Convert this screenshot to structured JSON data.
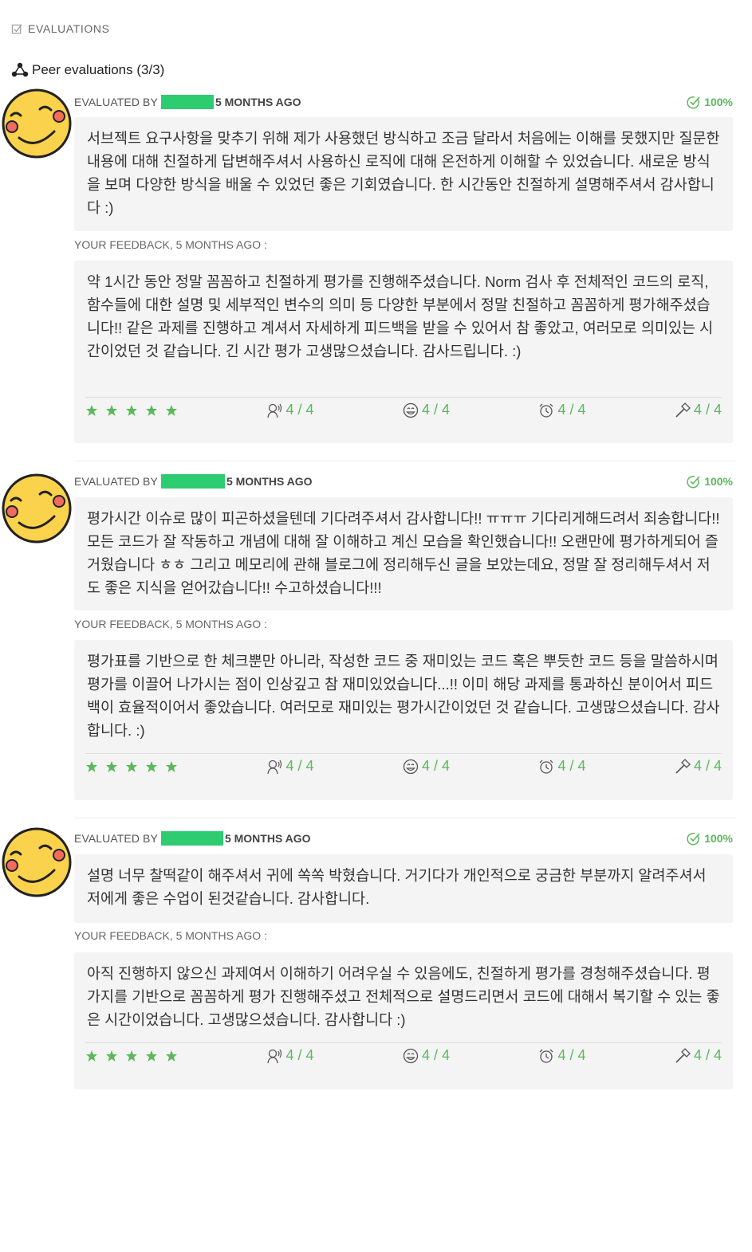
{
  "header": {
    "label": "EVALUATIONS"
  },
  "peer": {
    "title": "Peer evaluations (3/3)"
  },
  "colors": {
    "accent": "#5cb85c",
    "redact": "#2ecc71",
    "bubble": "#f4f4f4"
  },
  "evaluations": [
    {
      "evaluated_by": "EVALUATED BY",
      "ago": "5 MONTHS AGO",
      "percent": "100%",
      "comment": "서브젝트 요구사항을 맞추기 위해 제가 사용했던 방식하고 조금 달라서 처음에는 이해를 못했지만 질문한 내용에 대해 친절하게 답변해주셔서 사용하신 로직에 대해 온전하게 이해할 수 있었습니다. 새로운 방식을 보며 다양한 방식을 배울 수 있었던 좋은 기회였습니다. 한 시간동안 친절하게 설명해주셔서 감사합니다 :)",
      "feedback_label": "YOUR FEEDBACK, 5 MONTHS AGO :",
      "feedback": "약 1시간 동안 정말 꼼꼼하고 친절하게 평가를 진행해주셨습니다. Norm 검사 후 전체적인 코드의 로직, 함수들에 대한 설명 및 세부적인 변수의 의미 등 다양한 부분에서 정말 친절하고 꼼꼼하게 평가해주셨습니다!! 같은 과제를 진행하고 계셔서 자세하게 피드백을 받을 수 있어서 참 좋았고, 여러모로 의미있는 시간이었던 것 같습니다. 긴 시간 평가 고생많으셨습니다. 감사드립니다. :)",
      "scores": [
        "4 / 4",
        "4 / 4",
        "4 / 4",
        "4 / 4"
      ]
    },
    {
      "evaluated_by": "EVALUATED BY",
      "ago": "5 MONTHS AGO",
      "percent": "100%",
      "comment": "평가시간 이슈로 많이 피곤하셨을텐데 기다려주셔서 감사합니다!! ㅠㅠㅠ 기다리게해드려서 죄송합니다!! 모든 코드가 잘 작동하고 개념에 대해 잘 이해하고 계신 모습을 확인했습니다!! 오랜만에 평가하게되어 즐거웠습니다 ㅎㅎ 그리고 메모리에 관해 블로그에 정리해두신 글을 보았는데요, 정말 잘 정리해두셔서 저도 좋은 지식을 얻어갔습니다!! 수고하셨습니다!!!",
      "feedback_label": "YOUR FEEDBACK, 5 MONTHS AGO :",
      "feedback": "평가표를 기반으로 한 체크뿐만 아니라, 작성한 코드 중 재미있는 코드 혹은 뿌듯한 코드 등을 말씀하시며 평가를 이끌어 나가시는 점이 인상깊고 참 재미있었습니다...!! 이미 해당 과제를 통과하신 분이어서 피드백이 효율적이어서 좋았습니다. 여러모로 재미있는 평가시간이었던 것 같습니다. 고생많으셨습니다. 감사합니다. :)",
      "scores": [
        "4 / 4",
        "4 / 4",
        "4 / 4",
        "4 / 4"
      ]
    },
    {
      "evaluated_by": "EVALUATED BY",
      "ago": "5 MONTHS AGO",
      "percent": "100%",
      "comment": "설명 너무 찰떡같이 해주셔서 귀에 쏙쏙 박혔습니다. 거기다가 개인적으로 궁금한 부분까지 알려주셔서 저에게 좋은 수업이 된것같습니다. 감사합니다.",
      "feedback_label": "YOUR FEEDBACK, 5 MONTHS AGO :",
      "feedback": "아직 진행하지 않으신 과제여서 이해하기 어려우실 수 있음에도, 친절하게 평가를 경청해주셨습니다. 평가지를 기반으로 꼼꼼하게 평가 진행해주셨고 전체적으로 설명드리면서 코드에 대해서 복기할 수 있는 좋은 시간이었습니다. 고생많으셨습니다. 감사합니다 :)",
      "scores": [
        "4 / 4",
        "4 / 4",
        "4 / 4",
        "4 / 4"
      ]
    }
  ]
}
